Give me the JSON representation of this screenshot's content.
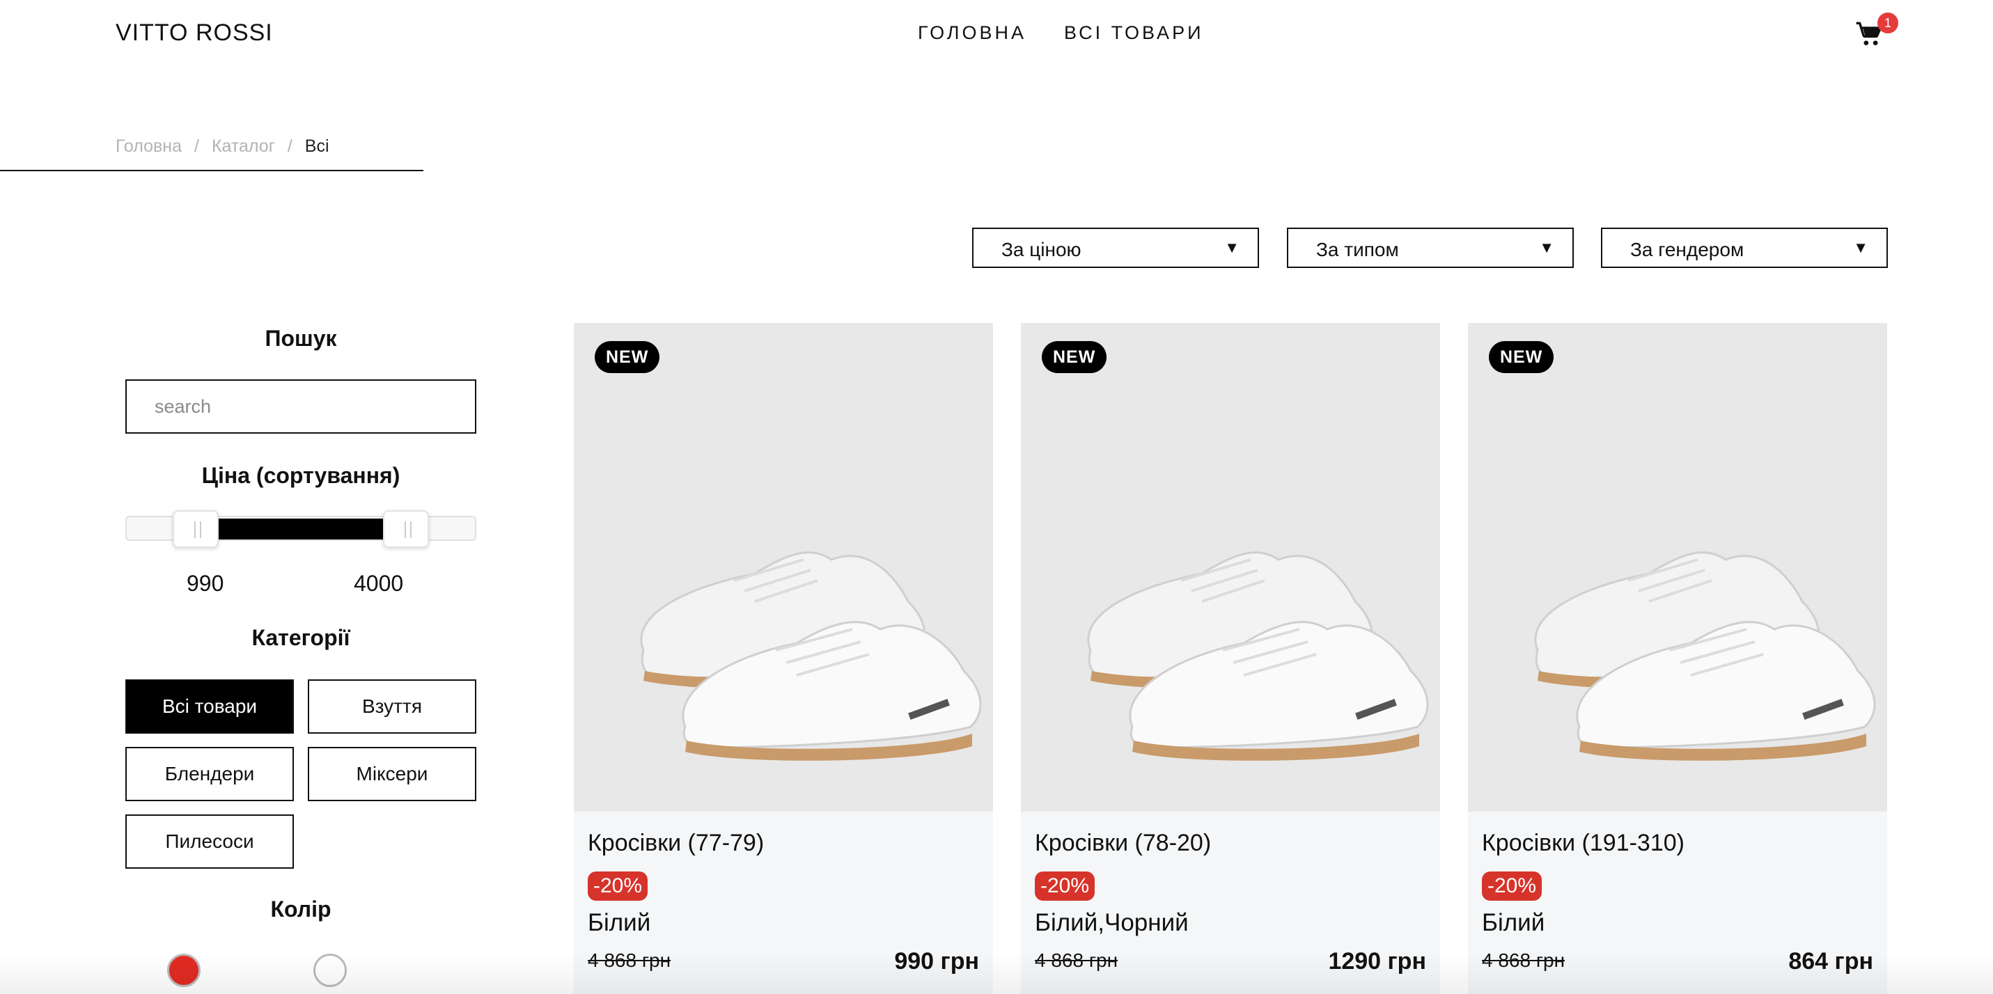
{
  "header": {
    "brand": "VITTO ROSSI",
    "nav": [
      "ГОЛОВНА",
      "ВСІ ТОВАРИ"
    ],
    "cart_count": "1"
  },
  "breadcrumb": {
    "items": [
      "Головна",
      "Каталог",
      "Всі"
    ],
    "separator": "/"
  },
  "filters": {
    "price": "За ціною",
    "type": "За типом",
    "gender": "За гендером",
    "arrow": "▼"
  },
  "sidebar": {
    "search_title": "Пошук",
    "search_placeholder": "search",
    "price_title": "Ціна (сортування)",
    "price_min": "990",
    "price_max": "4000",
    "categories_title": "Категорії",
    "categories": [
      "Всі товари",
      "Взуття",
      "Блендери",
      "Міксери",
      "Пилесоси"
    ],
    "color_title": "Колір",
    "color_swatches": [
      "#e02b22",
      "#ffffff"
    ]
  },
  "products": [
    {
      "badge": "NEW",
      "name": "Кросівки (77-79)",
      "discount": "-20%",
      "color": "Білий",
      "old_price": "4 868 грн",
      "price": "990 грн"
    },
    {
      "badge": "NEW",
      "name": "Кросівки (78-20)",
      "discount": "-20%",
      "color": "Білий,Чорний",
      "old_price": "4 868 грн",
      "price": "1290 грн"
    },
    {
      "badge": "NEW",
      "name": "Кросівки (191-310)",
      "discount": "-20%",
      "color": "Білий",
      "old_price": "4 868 грн",
      "price": "864 грн"
    }
  ]
}
